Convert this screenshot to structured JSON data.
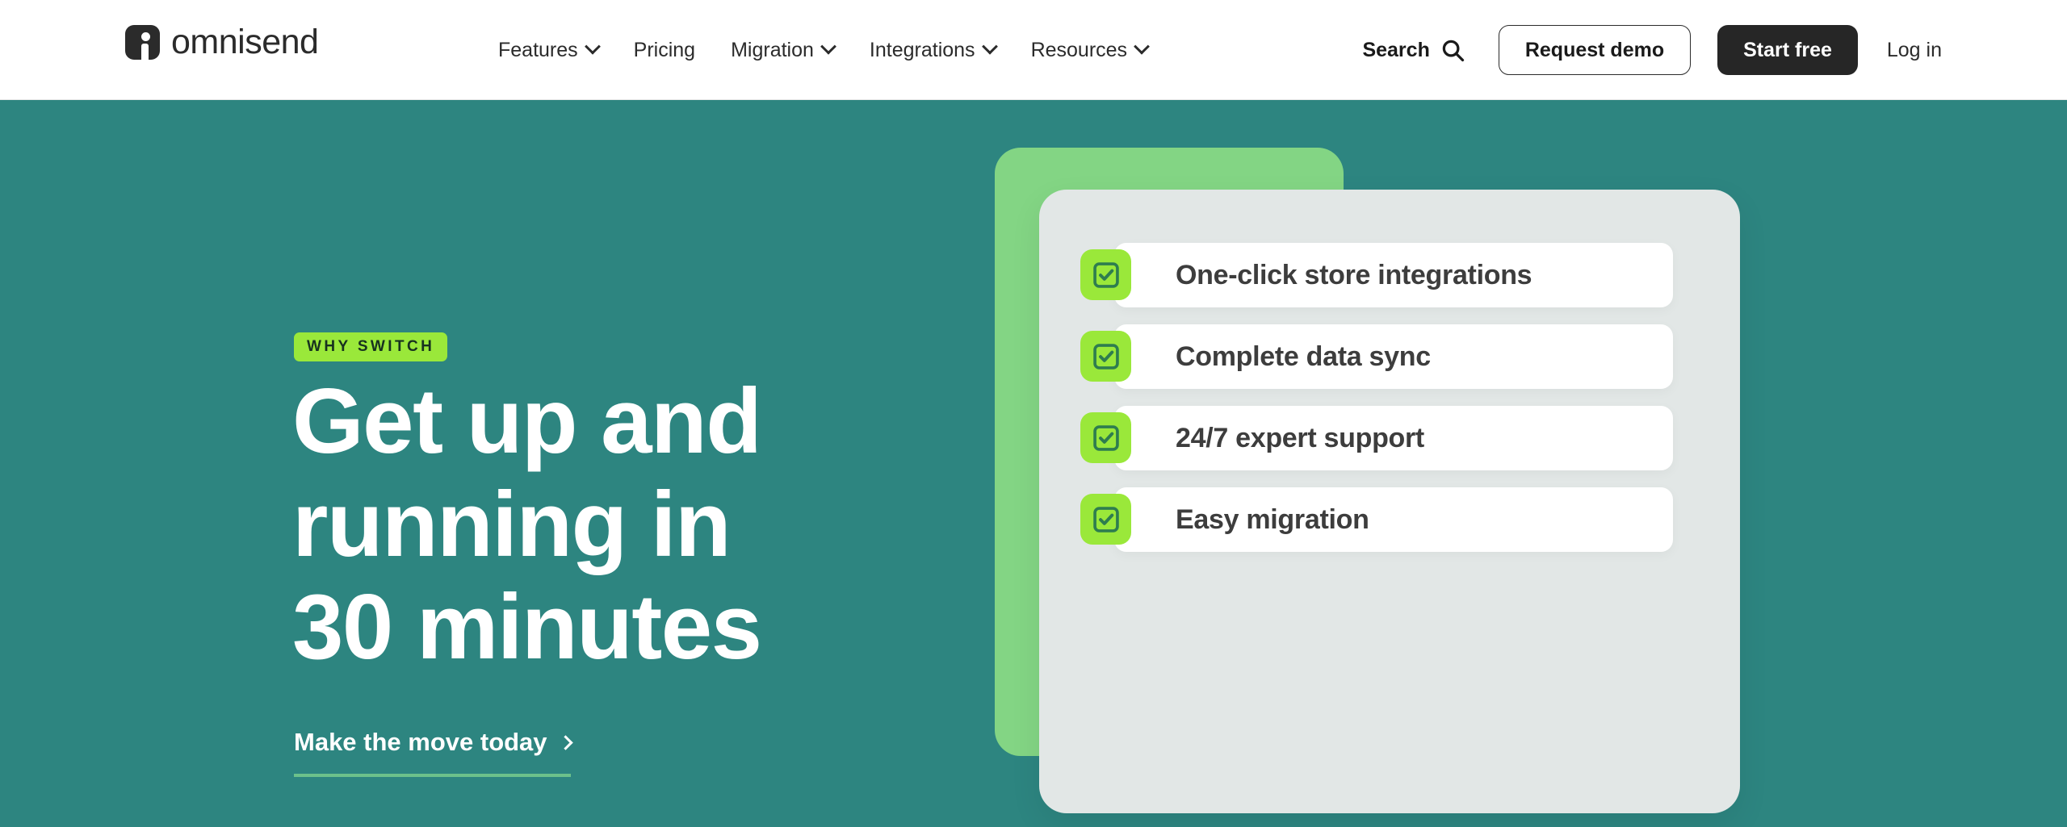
{
  "brand": {
    "name": "omnisend",
    "logo_icon": "omnisend-logo-icon",
    "logo_bg": "#2b2b2b"
  },
  "header": {
    "nav_items": [
      {
        "label": "Features",
        "has_dropdown": true,
        "icon": "chevron-down-icon"
      },
      {
        "label": "Pricing",
        "has_dropdown": false,
        "icon": ""
      },
      {
        "label": "Migration",
        "has_dropdown": true,
        "icon": "chevron-down-icon"
      },
      {
        "label": "Integrations",
        "has_dropdown": true,
        "icon": "chevron-down-icon"
      },
      {
        "label": "Resources",
        "has_dropdown": true,
        "icon": "chevron-down-icon"
      }
    ],
    "search": {
      "label": "Search",
      "icon": "search-icon"
    },
    "request_demo_label": "Request demo",
    "start_free_label": "Start free",
    "login_label": "Log in",
    "bg": "#ffffff",
    "text_color": "#2b2b2b",
    "start_free_bg": "#262626"
  },
  "hero": {
    "bg": "#2d8580",
    "badge": {
      "label": "WHY SWITCH",
      "bg": "#9ae83a",
      "text_color": "#17321f"
    },
    "headline_lines": [
      "Get up and",
      "running in",
      "30 minutes"
    ],
    "cta": {
      "label": "Make the move today",
      "icon": "chevron-right-icon",
      "underline_color": "#6cc18b"
    }
  },
  "card_stack": {
    "back_card_color": "#83d584",
    "mid_card_color": "#e2e7e6",
    "row_color": "#ffffff",
    "check_bg": "#9ae83a",
    "check_stroke": "#2e7d4f",
    "rows": [
      {
        "label": "One-click store integrations",
        "icon": "checkbox-checked-icon"
      },
      {
        "label": "Complete data sync",
        "icon": "checkbox-checked-icon"
      },
      {
        "label": "24/7 expert support",
        "icon": "checkbox-checked-icon"
      },
      {
        "label": "Easy migration",
        "icon": "checkbox-checked-icon"
      }
    ]
  }
}
